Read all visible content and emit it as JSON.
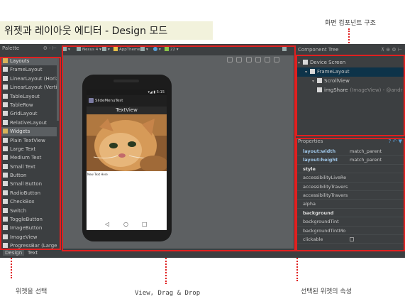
{
  "heading": "위젯과 레이아웃 에디터 - Design 모드",
  "annotations": {
    "component_screen": "화면 컴포넌트 구조",
    "select_widget": "위젯을 선택",
    "view_drag_drop": "View, Drag & Drop",
    "selected_props": "선택된 위젯의 속성"
  },
  "palette": {
    "title": "Palette",
    "controls": "⚙ - ⊢",
    "items": [
      {
        "label": "Layouts",
        "category": true
      },
      {
        "label": "FrameLayout",
        "category": false
      },
      {
        "label": "LinearLayout (Horiz",
        "category": false
      },
      {
        "label": "LinearLayout (Verti",
        "category": false
      },
      {
        "label": "TableLayout",
        "category": false
      },
      {
        "label": "TableRow",
        "category": false
      },
      {
        "label": "GridLayout",
        "category": false
      },
      {
        "label": "RelativeLayout",
        "category": false
      },
      {
        "label": "Widgets",
        "category": true
      },
      {
        "label": "Plain TextView",
        "category": false
      },
      {
        "label": "Large Text",
        "category": false
      },
      {
        "label": "Medium Text",
        "category": false
      },
      {
        "label": "Small Text",
        "category": false
      },
      {
        "label": "Button",
        "category": false
      },
      {
        "label": "Small Button",
        "category": false
      },
      {
        "label": "RadioButton",
        "category": false
      },
      {
        "label": "CheckBox",
        "category": false
      },
      {
        "label": "Switch",
        "category": false
      },
      {
        "label": "ToggleButton",
        "category": false
      },
      {
        "label": "ImageButton",
        "category": false
      },
      {
        "label": "ImageView",
        "category": false
      },
      {
        "label": "ProgressBar (Large)",
        "category": false
      }
    ]
  },
  "bottom_tabs": {
    "design": "Design",
    "text": "Text"
  },
  "toolbar": {
    "device": "Nexus 4",
    "theme": "AppTheme",
    "api": "22"
  },
  "phone": {
    "time": "5:15",
    "app_title": "SlideMenuTest",
    "textview": "TextView",
    "tiny_text": "New Text Here"
  },
  "component_tree": {
    "title": "Component Tree",
    "rows": [
      {
        "label": "Device Screen",
        "extra": "",
        "selected": false,
        "indent": 0
      },
      {
        "label": "FrameLayout",
        "extra": "",
        "selected": true,
        "indent": 1
      },
      {
        "label": "ScrollView",
        "extra": "",
        "selected": false,
        "indent": 2
      },
      {
        "label": "imgShare",
        "extra": "(ImageView) - @andr",
        "selected": false,
        "indent": 2
      }
    ]
  },
  "properties": {
    "title": "Properties",
    "rows": [
      {
        "key": "layout:width",
        "value": "match_parent",
        "style": "hl"
      },
      {
        "key": "layout:height",
        "value": "match_parent",
        "style": "hl"
      },
      {
        "key": "style",
        "value": "",
        "style": "bold"
      },
      {
        "key": "accessibilityLiveRe",
        "value": "",
        "style": ""
      },
      {
        "key": "accessibilityTravers",
        "value": "",
        "style": ""
      },
      {
        "key": "accessibilityTravers",
        "value": "",
        "style": ""
      },
      {
        "key": "alpha",
        "value": "",
        "style": ""
      },
      {
        "key": "background",
        "value": "",
        "style": "bold"
      },
      {
        "key": "backgroundTint",
        "value": "",
        "style": ""
      },
      {
        "key": "backgroundTintMo",
        "value": "",
        "style": ""
      },
      {
        "key": "clickable",
        "value": "",
        "style": "check"
      }
    ]
  }
}
